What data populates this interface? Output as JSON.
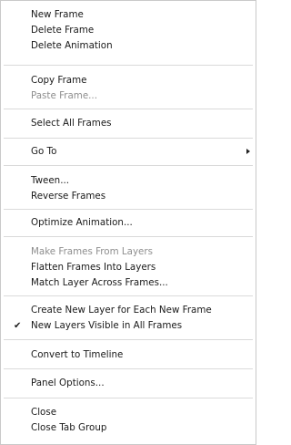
{
  "menu": {
    "new_frame": "New Frame",
    "delete_frame": "Delete Frame",
    "delete_animation": "Delete Animation",
    "copy_frame": "Copy Frame",
    "paste_frame": "Paste Frame...",
    "select_all_frames": "Select All Frames",
    "go_to": "Go To",
    "tween": "Tween...",
    "reverse_frames": "Reverse Frames",
    "optimize_animation": "Optimize Animation...",
    "make_frames_from_layers": "Make Frames From Layers",
    "flatten_frames_into_layers": "Flatten Frames Into Layers",
    "match_layer_across_frames": "Match Layer Across Frames...",
    "create_new_layer_each_frame": "Create New Layer for Each New Frame",
    "new_layers_visible": "New Layers Visible in All Frames",
    "convert_to_timeline": "Convert to Timeline",
    "panel_options": "Panel Options...",
    "close": "Close",
    "close_tab_group": "Close Tab Group",
    "checkmark_glyph": "✔"
  }
}
